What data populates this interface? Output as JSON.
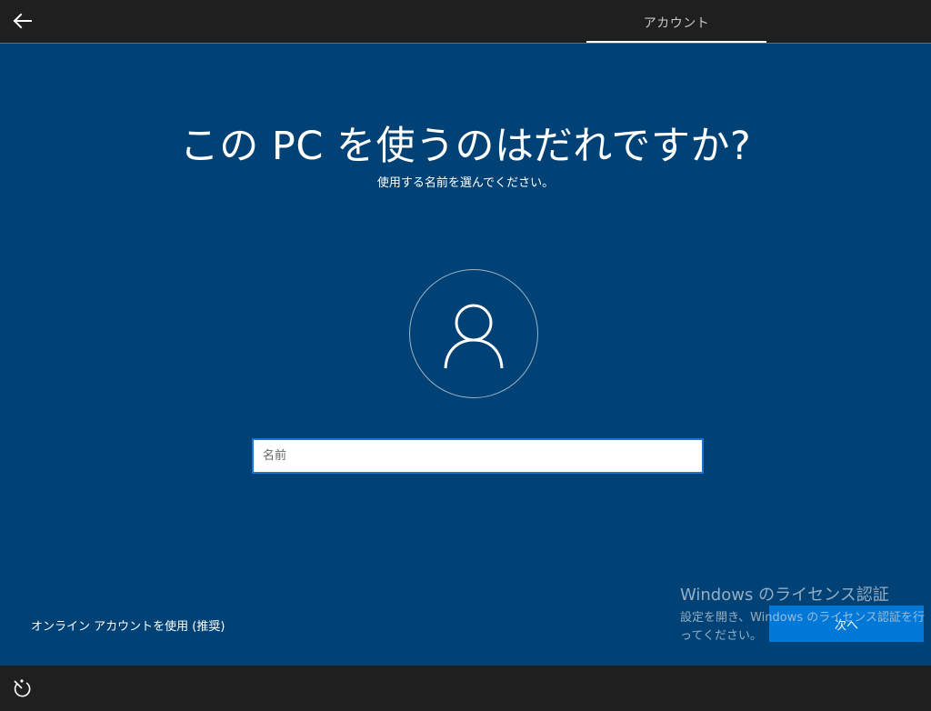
{
  "topbar": {
    "back_icon": "arrow-left-icon",
    "tab_label": "アカウント"
  },
  "main": {
    "headline": "この PC を使うのはだれですか?",
    "subline": "使用する名前を選んでください。",
    "avatar_icon": "user-icon",
    "name_field": {
      "placeholder": "名前",
      "value": ""
    }
  },
  "footer": {
    "online_account_link": "オンライン アカウントを使用 (推奨)",
    "next_button": "次へ",
    "accessibility_icon": "ease-of-access-icon"
  },
  "watermark": {
    "title": "Windows のライセンス認証",
    "body": "設定を開き、Windows のライセンス認証を行ってください。"
  },
  "colors": {
    "background": "#004275",
    "bar": "#1f1f1f",
    "accent": "#0078d7",
    "field_border": "#1a73d9"
  }
}
